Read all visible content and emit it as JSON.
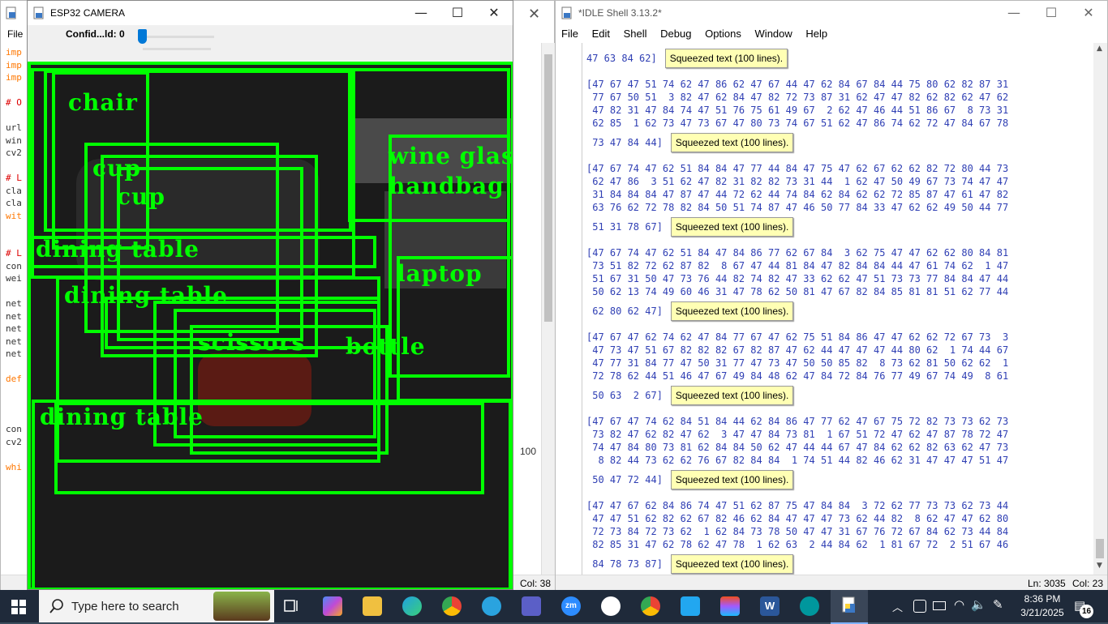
{
  "editor": {
    "menu_file": "File",
    "code_lines": [
      {
        "text": "imp",
        "cls": "kw"
      },
      {
        "text": "imp",
        "cls": "kw"
      },
      {
        "text": "imp",
        "cls": "kw"
      },
      {
        "text": "",
        "cls": "dk"
      },
      {
        "text": "# O",
        "cls": "cm"
      },
      {
        "text": "",
        "cls": "dk"
      },
      {
        "text": "url",
        "cls": "dk"
      },
      {
        "text": "win",
        "cls": "dk"
      },
      {
        "text": "cv2",
        "cls": "dk"
      },
      {
        "text": "",
        "cls": "dk"
      },
      {
        "text": "# L",
        "cls": "cm"
      },
      {
        "text": "cla",
        "cls": "dk"
      },
      {
        "text": "cla",
        "cls": "dk"
      },
      {
        "text": "wit",
        "cls": "kw"
      },
      {
        "text": "",
        "cls": "dk"
      },
      {
        "text": "",
        "cls": "dk"
      },
      {
        "text": "# L",
        "cls": "cm"
      },
      {
        "text": "con",
        "cls": "dk"
      },
      {
        "text": "wei",
        "cls": "dk"
      },
      {
        "text": "",
        "cls": "dk"
      },
      {
        "text": "net",
        "cls": "dk"
      },
      {
        "text": "net",
        "cls": "dk"
      },
      {
        "text": "net",
        "cls": "dk"
      },
      {
        "text": "net",
        "cls": "dk"
      },
      {
        "text": "net",
        "cls": "dk"
      },
      {
        "text": "",
        "cls": "dk"
      },
      {
        "text": "def",
        "cls": "kw"
      },
      {
        "text": "",
        "cls": "dk"
      },
      {
        "text": "",
        "cls": "dk"
      },
      {
        "text": "",
        "cls": "dk"
      },
      {
        "text": "con",
        "cls": "dk"
      },
      {
        "text": "cv2",
        "cls": "dk"
      },
      {
        "text": "",
        "cls": "dk"
      },
      {
        "text": "whi",
        "cls": "kw"
      }
    ],
    "right_fragment": "100",
    "status_col": "Col: 38"
  },
  "camera": {
    "title": "ESP32 CAMERA",
    "confidence_label": "Confid...ld: 0",
    "confidence_value": 0,
    "detections": [
      "chair",
      "cup",
      "cup",
      "dining table",
      "dining table",
      "dining table",
      "wine glass",
      "handbag",
      "scissors",
      "bottle",
      "laptop"
    ]
  },
  "idle": {
    "title": "*IDLE Shell 3.13.2*",
    "menu": [
      "File",
      "Edit",
      "Shell",
      "Debug",
      "Options",
      "Window",
      "Help"
    ],
    "squeezed_label": "Squeezed text (100 lines).",
    "blocks": [
      {
        "lines": [],
        "tail": "47 63 84 62]"
      },
      {
        "lines": [
          "[47 67 47 51 74 62 47 86 62 47 67 44 47 62 84 67 84 44 75 80 62 82 87 31",
          " 77 67 50 51  3 82 47 62 84 47 82 72 73 87 31 62 47 47 82 62 82 62 47 62",
          " 47 82 31 47 84 74 47 51 76 75 61 49 67  2 62 47 46 44 51 86 67  8 73 31",
          " 62 85  1 62 73 47 73 67 47 80 73 74 67 51 62 47 86 74 62 72 47 84 67 78"
        ],
        "tail": " 73 47 84 44]"
      },
      {
        "lines": [
          "[47 67 74 47 62 51 84 84 47 77 44 84 47 75 47 62 67 62 62 82 72 80 44 73",
          " 62 47 86  3 51 62 47 82 31 82 82 73 31 44  1 62 47 50 49 67 73 74 47 47",
          " 31 84 84 84 47 87 47 44 72 62 44 74 84 62 84 62 62 72 85 87 47 61 47 82",
          " 63 76 62 72 78 82 84 50 51 74 87 47 46 50 77 84 33 47 62 62 49 50 44 77"
        ],
        "tail": " 51 31 78 67]"
      },
      {
        "lines": [
          "[47 67 74 47 62 51 84 47 84 86 77 62 67 84  3 62 75 47 47 62 62 80 84 81",
          " 73 51 82 72 62 87 82  8 67 47 44 81 84 47 82 84 84 44 47 61 74 62  1 47",
          " 51 67 31 50 47 73 76 44 82 74 82 47 33 62 62 47 51 73 73 77 84 84 47 44",
          " 50 62 13 74 49 60 46 31 47 78 62 50 81 47 67 82 84 85 81 81 51 62 77 44"
        ],
        "tail": " 62 80 62 47]"
      },
      {
        "lines": [
          "[47 67 47 62 74 62 47 84 77 67 47 62 75 51 84 86 47 47 62 62 72 67 73  3",
          " 47 73 47 51 67 82 82 82 67 82 87 47 62 44 47 47 47 44 80 62  1 74 44 67",
          " 47 77 31 84 77 47 50 31 77 47 73 47 50 50 85 82  8 73 62 81 50 62 62  1",
          " 72 78 62 44 51 46 47 67 49 84 48 62 47 84 72 84 76 77 49 67 74 49  8 61"
        ],
        "tail": " 50 63  2 67]"
      },
      {
        "lines": [
          "[47 67 47 74 62 84 51 84 44 62 84 86 47 77 62 47 67 75 72 82 73 73 62 73",
          " 73 82 47 62 82 47 62  3 47 47 84 73 81  1 67 51 72 47 62 47 87 78 72 47",
          " 74 47 84 80 73 81 62 84 84 50 62 47 44 44 67 47 84 62 62 82 63 62 47 73",
          "  8 82 44 73 62 62 76 67 82 84 84  1 74 51 44 82 46 62 31 47 47 47 51 47"
        ],
        "tail": " 50 47 72 44]"
      },
      {
        "lines": [
          "[47 47 67 62 84 86 74 47 51 62 87 75 47 84 84  3 72 62 77 73 73 62 73 44",
          " 47 47 51 62 82 62 67 82 46 62 84 47 47 47 73 62 44 82  8 62 47 47 62 80",
          " 72 73 84 72 73 62  1 62 84 73 78 50 47 47 31 67 76 72 67 84 62 73 44 84",
          " 82 85 31 47 62 78 62 47 78  1 62 63  2 44 84 62  1 81 67 72  2 51 67 46"
        ],
        "tail": " 84 78 73 87]"
      }
    ],
    "status_ln": "Ln: 3035",
    "status_col": "Col: 23"
  },
  "taskbar": {
    "search_placeholder": "Type here to search",
    "time": "8:36 PM",
    "date": "3/21/2025",
    "notification_count": "16"
  }
}
